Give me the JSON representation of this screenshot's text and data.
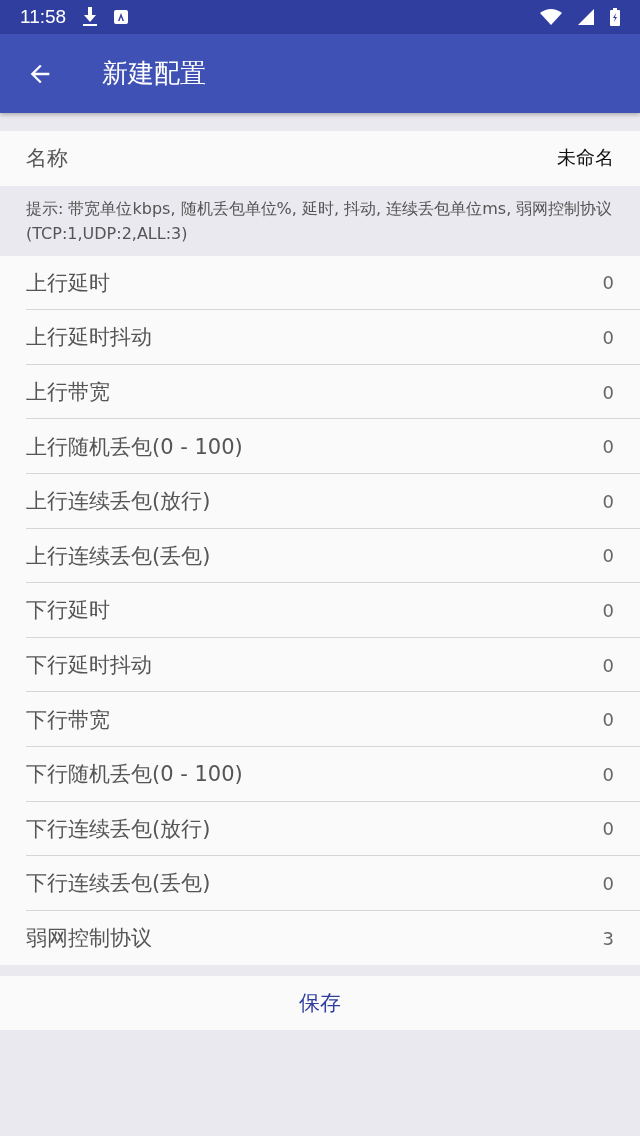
{
  "status_bar": {
    "time": "11:58"
  },
  "app_bar": {
    "title": "新建配置"
  },
  "name_row": {
    "label": "名称",
    "value": "未命名"
  },
  "hint": "提示: 带宽单位kbps, 随机丢包单位%, 延时, 抖动, 连续丢包单位ms, 弱网控制协议(TCP:1,UDP:2,ALL:3)",
  "settings": [
    {
      "label": "上行延时",
      "value": "0"
    },
    {
      "label": "上行延时抖动",
      "value": "0"
    },
    {
      "label": "上行带宽",
      "value": "0"
    },
    {
      "label": "上行随机丢包(0 - 100)",
      "value": "0"
    },
    {
      "label": "上行连续丢包(放行)",
      "value": "0"
    },
    {
      "label": "上行连续丢包(丢包)",
      "value": "0"
    },
    {
      "label": "下行延时",
      "value": "0"
    },
    {
      "label": "下行延时抖动",
      "value": "0"
    },
    {
      "label": "下行带宽",
      "value": "0"
    },
    {
      "label": "下行随机丢包(0 - 100)",
      "value": "0"
    },
    {
      "label": "下行连续丢包(放行)",
      "value": "0"
    },
    {
      "label": "下行连续丢包(丢包)",
      "value": "0"
    },
    {
      "label": "弱网控制协议",
      "value": "3"
    }
  ],
  "save_button": "保存"
}
